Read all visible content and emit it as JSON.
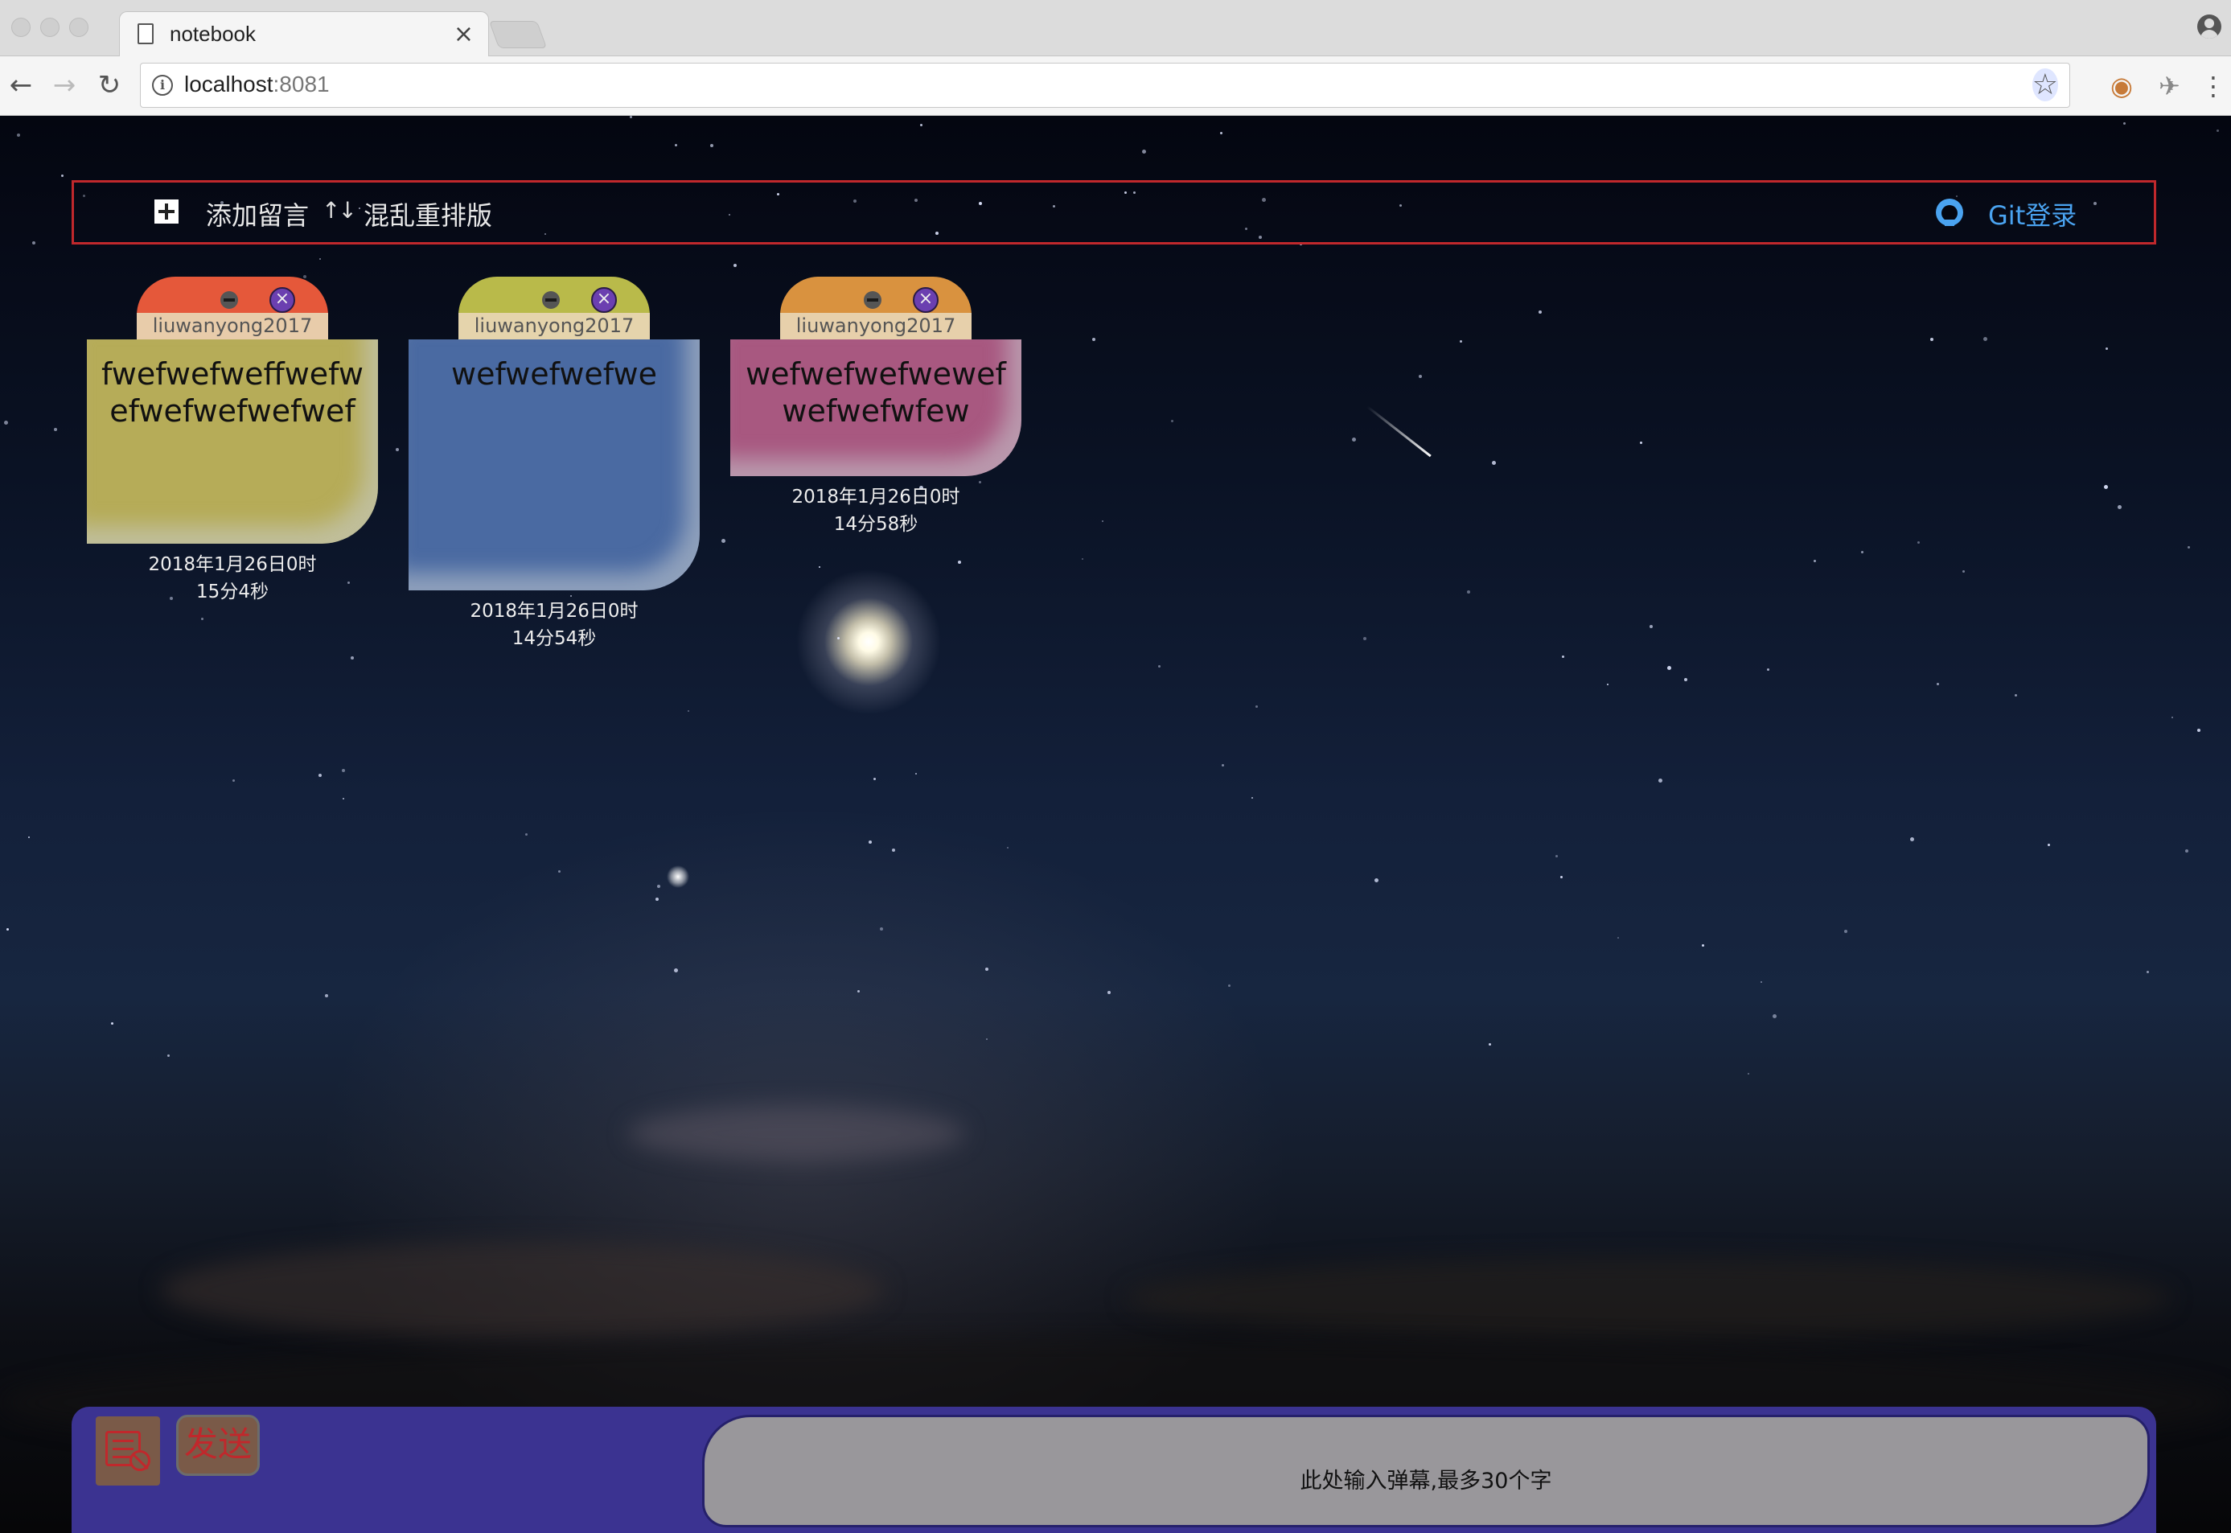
{
  "browser": {
    "tab_title": "notebook",
    "tab_close": "×",
    "url_host": "localhost",
    "url_port": ":8081"
  },
  "navbar": {
    "add_message": "添加留言",
    "sort_icon": "↑↓",
    "shuffle_layout": "混乱重排版",
    "git_login": "Git登录"
  },
  "notes": [
    {
      "author": "liuwanyong2017",
      "content": "fwefwefweffwefwefwefwefwefwef",
      "time_line1": "2018年1月26日0时",
      "time_line2": "15分4秒",
      "tab_color": "#e5583a",
      "body_color": "#b6ac58"
    },
    {
      "author": "liuwanyong2017",
      "content": "wefwefwefwe",
      "time_line1": "2018年1月26日0时",
      "time_line2": "14分54秒",
      "tab_color": "#b9ba4a",
      "body_color": "#4a6aa2"
    },
    {
      "author": "liuwanyong2017",
      "content": "wefwefwefwewefwefwefwfew",
      "time_line1": "2018年1月26日0时",
      "time_line2": "14分58秒",
      "tab_color": "#d9923f",
      "body_color": "#a85880"
    }
  ],
  "bottombar": {
    "send_label": "发送",
    "input_placeholder": "此处输入弹幕,最多30个字"
  }
}
